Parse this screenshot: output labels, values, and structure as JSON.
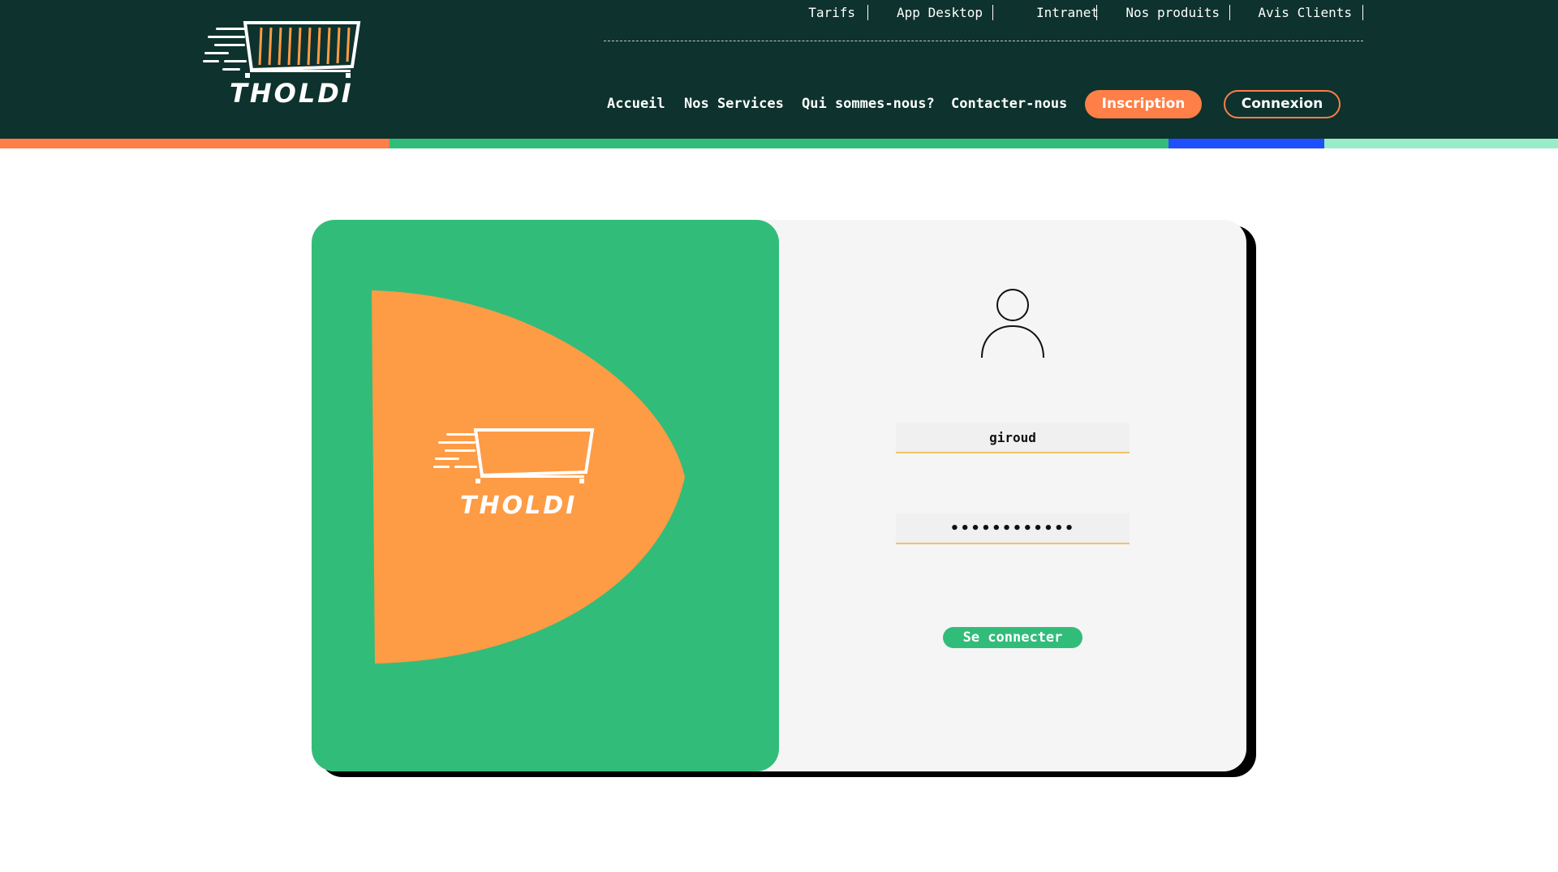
{
  "brand": {
    "name": "THOLDI"
  },
  "colors": {
    "header_bg": "#0e322d",
    "accent_orange": "#fe7f47",
    "accent_green": "#32bc7a",
    "stripe_blue": "#1f4fff",
    "stripe_mint": "#99ecc8",
    "blob_orange": "#fe9b45"
  },
  "topnav": {
    "items": [
      {
        "label": "Tarifs"
      },
      {
        "label": "App Desktop"
      },
      {
        "label": "Intranet"
      },
      {
        "label": "Nos produits"
      },
      {
        "label": "Avis Clients"
      }
    ]
  },
  "mainnav": {
    "items": [
      {
        "label": "Accueil"
      },
      {
        "label": "Nos Services"
      },
      {
        "label": "Qui sommes-nous?"
      },
      {
        "label": "Contacter-nous"
      }
    ],
    "inscription_label": "Inscription",
    "connexion_label": "Connexion"
  },
  "login": {
    "avatar_icon": "user-icon",
    "username_value": "giroud",
    "password_value": "••••••••••••",
    "submit_label": "Se connecter"
  }
}
